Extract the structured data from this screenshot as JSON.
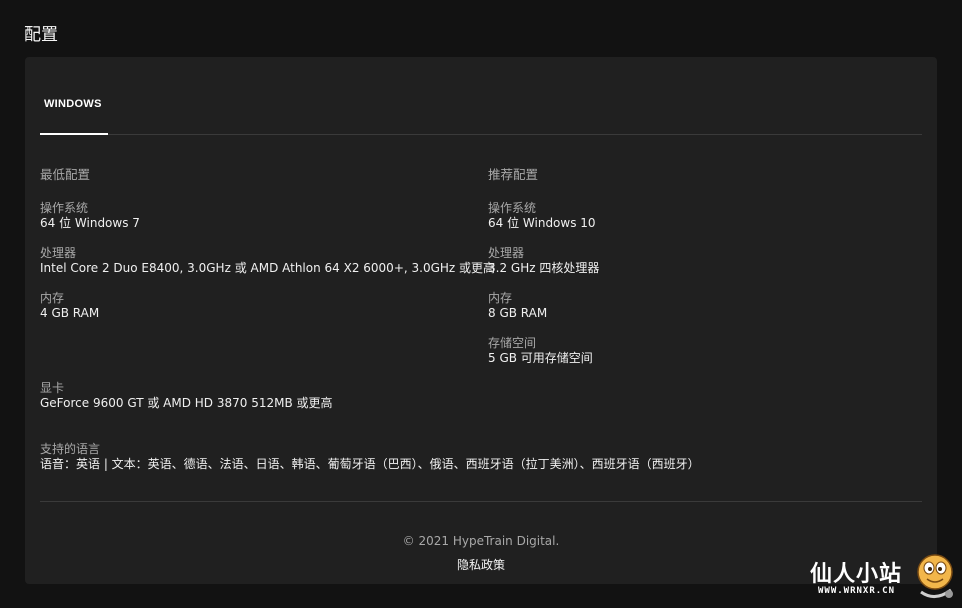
{
  "page": {
    "title": "配置"
  },
  "tabs": [
    {
      "label": "WINDOWS",
      "active": true
    }
  ],
  "minimum": {
    "heading": "最低配置",
    "specs": [
      {
        "label": "操作系统",
        "value": "64 位 Windows 7"
      },
      {
        "label": "处理器",
        "value": "Intel Core 2 Duo E8400, 3.0GHz 或 AMD Athlon 64 X2 6000+, 3.0GHz 或更高"
      },
      {
        "label": "内存",
        "value": "4 GB RAM"
      },
      {
        "label": "显卡",
        "value": "GeForce 9600 GT 或 AMD HD 3870 512MB 或更高"
      }
    ]
  },
  "recommended": {
    "heading": "推荐配置",
    "specs": [
      {
        "label": "操作系统",
        "value": "64 位 Windows 10"
      },
      {
        "label": "处理器",
        "value": "3.2 GHz 四核处理器"
      },
      {
        "label": "内存",
        "value": "8 GB RAM"
      },
      {
        "label": "存储空间",
        "value": "5 GB 可用存储空间"
      }
    ]
  },
  "languages": {
    "label": "支持的语言",
    "value": "语音：英语 | 文本：英语、德语、法语、日语、韩语、葡萄牙语（巴西）、俄语、西班牙语（拉丁美洲）、西班牙语（西班牙）"
  },
  "footer": {
    "copyright": "© 2021 HypeTrain Digital.",
    "privacy_link": "隐私政策"
  },
  "watermark": {
    "text": "仙人小站",
    "url": "WWW.WRNXR.CN"
  },
  "colors": {
    "background": "#121212",
    "panel": "#202020",
    "label": "#a8a8a8",
    "value": "#f0f0f0"
  }
}
